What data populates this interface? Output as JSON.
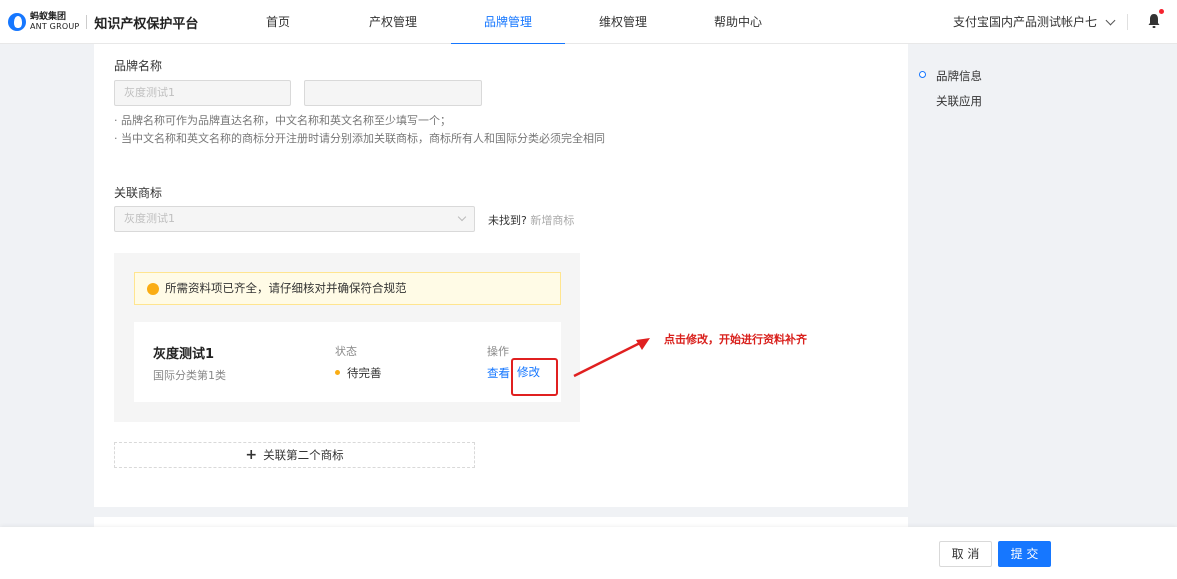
{
  "header": {
    "logo_cn": "蚂蚁集团",
    "logo_en": "ANT GROUP",
    "platform_title": "知识产权保护平台",
    "nav": [
      {
        "label": "首页"
      },
      {
        "label": "产权管理"
      },
      {
        "label": "品牌管理",
        "active": true
      },
      {
        "label": "维权管理"
      },
      {
        "label": "帮助中心"
      }
    ],
    "account_name": "支付宝国内产品测试帐户七"
  },
  "form": {
    "brand_name_label": "品牌名称",
    "brand_name_cn_value": "灰度测试1",
    "brand_name_en_value": "",
    "hint_1": "· 品牌名称可作为品牌直达名称，中文名称和英文名称至少填写一个；",
    "hint_2": "· 当中文名称和英文名称的商标分开注册时请分别添加关联商标，商标所有人和国际分类必须完全相同",
    "trademark_label": "关联商标",
    "trademark_select_value": "灰度测试1",
    "not_found_text": "未找到?",
    "add_trademark_link": "新增商标",
    "alert_text": "所需资料项已齐全，请仔细核对并确保符合规范",
    "trademark_card": {
      "name": "灰度测试1",
      "class": "国际分类第1类",
      "status_header": "状态",
      "status_value": "待完善",
      "action_header": "操作",
      "action_view": "查看",
      "action_edit": "修改"
    },
    "annotation_note": "点击修改，开始进行资料补齐",
    "add_second_trademark": "关联第二个商标"
  },
  "anchor_nav": [
    {
      "label": "品牌信息",
      "active": true
    },
    {
      "label": "关联应用"
    }
  ],
  "footer": {
    "cancel_label": "取 消",
    "submit_label": "提 交"
  },
  "colors": {
    "primary": "#1677ff",
    "warning": "#faad14",
    "annotation_red": "#e02020"
  }
}
